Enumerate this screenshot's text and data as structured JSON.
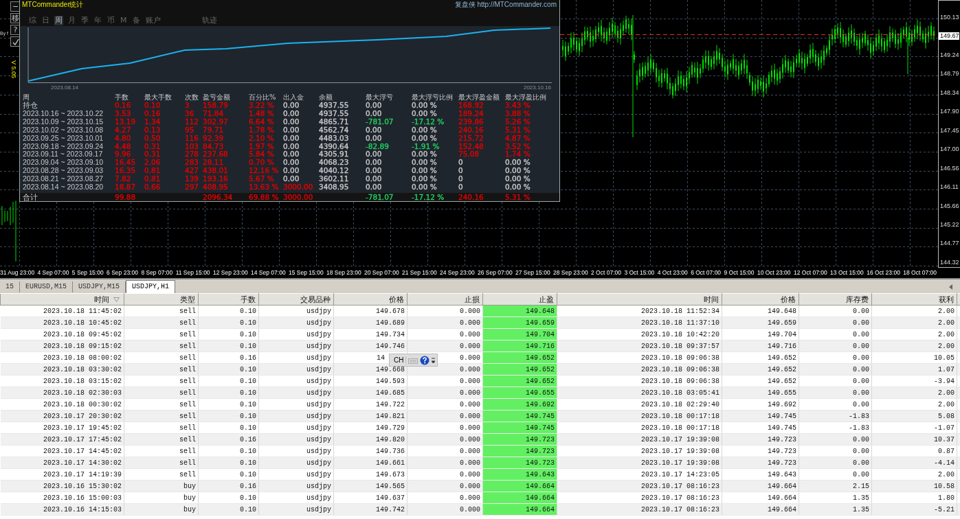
{
  "left_tools": {
    "buttons": [
      "−",
      "移",
      "?"
    ],
    "side_text": "By f",
    "vertical_label": "V 5.05"
  },
  "stats_panel": {
    "title": "MTCommander统计",
    "link": "复盘侠 http://MTCommander.com",
    "tabs": [
      {
        "label": "综",
        "selected": false
      },
      {
        "label": "日",
        "selected": false
      },
      {
        "label": "周",
        "selected": true
      },
      {
        "label": "月",
        "selected": false
      },
      {
        "label": "季",
        "selected": false
      },
      {
        "label": "年",
        "selected": false
      },
      {
        "label": "币",
        "selected": false
      },
      {
        "label": "M",
        "selected": false
      },
      {
        "label": "备",
        "selected": false
      },
      {
        "label": "账户",
        "selected": false
      },
      {
        "label": "轨迹",
        "selected": false
      }
    ],
    "curve_dates": [
      "2023.08.14",
      "2023.10.16"
    ],
    "label_column": "周",
    "columns": [
      "手数",
      "最大手数",
      "次数",
      "盈亏金额",
      "百分比%",
      "出入金",
      "余额",
      "最大浮亏",
      "最大浮亏比例",
      "最大浮盈金额",
      "最大浮盈比例"
    ],
    "rows": [
      {
        "label": "持仓",
        "cells": [
          {
            "text": "0.16",
            "color": "#e00000"
          },
          {
            "text": "0.10",
            "color": "#e00000"
          },
          {
            "text": "3",
            "color": "#e00000"
          },
          {
            "text": "158.79",
            "color": "#e00000"
          },
          {
            "text": "3.22 %",
            "color": "#e00000"
          },
          {
            "text": "0.00",
            "color": "#c8c8c8"
          },
          {
            "text": "4937.55",
            "color": "#c8c8c8"
          },
          {
            "text": "0.00",
            "color": "#c8c8c8"
          },
          {
            "text": "0.00 %",
            "color": "#c8c8c8"
          },
          {
            "text": "168.92",
            "color": "#e00000"
          },
          {
            "text": "3.43 %",
            "color": "#e00000"
          }
        ]
      },
      {
        "label": "2023.10.16 ~ 2023.10.22",
        "cells": [
          {
            "text": "3.53",
            "color": "#e00000"
          },
          {
            "text": "0.16",
            "color": "#e00000"
          },
          {
            "text": "36",
            "color": "#e00000"
          },
          {
            "text": "71.84",
            "color": "#e00000"
          },
          {
            "text": "1.48 %",
            "color": "#e00000"
          },
          {
            "text": "0.00",
            "color": "#c8c8c8"
          },
          {
            "text": "4937.55",
            "color": "#c8c8c8"
          },
          {
            "text": "0.00",
            "color": "#c8c8c8"
          },
          {
            "text": "0.00 %",
            "color": "#c8c8c8"
          },
          {
            "text": "189.24",
            "color": "#e00000"
          },
          {
            "text": "3.88 %",
            "color": "#e00000"
          }
        ]
      },
      {
        "label": "2023.10.09 ~ 2023.10.15",
        "cells": [
          {
            "text": "13.19",
            "color": "#e00000"
          },
          {
            "text": "1.34",
            "color": "#e00000"
          },
          {
            "text": "112",
            "color": "#e00000"
          },
          {
            "text": "302.97",
            "color": "#e00000"
          },
          {
            "text": "6.64 %",
            "color": "#e00000"
          },
          {
            "text": "0.00",
            "color": "#c8c8c8"
          },
          {
            "text": "4865.71",
            "color": "#c8c8c8"
          },
          {
            "text": "-781.07",
            "color": "#20d060"
          },
          {
            "text": "-17.12 %",
            "color": "#20d060"
          },
          {
            "text": "239.86",
            "color": "#e00000"
          },
          {
            "text": "5.26 %",
            "color": "#e00000"
          }
        ]
      },
      {
        "label": "2023.10.02 ~ 2023.10.08",
        "cells": [
          {
            "text": "4.27",
            "color": "#e00000"
          },
          {
            "text": "0.13",
            "color": "#e00000"
          },
          {
            "text": "95",
            "color": "#e00000"
          },
          {
            "text": "79.71",
            "color": "#e00000"
          },
          {
            "text": "1.78 %",
            "color": "#e00000"
          },
          {
            "text": "0.00",
            "color": "#c8c8c8"
          },
          {
            "text": "4562.74",
            "color": "#c8c8c8"
          },
          {
            "text": "0.00",
            "color": "#c8c8c8"
          },
          {
            "text": "0.00 %",
            "color": "#c8c8c8"
          },
          {
            "text": "240.16",
            "color": "#e00000"
          },
          {
            "text": "5.31 %",
            "color": "#e00000"
          }
        ]
      },
      {
        "label": "2023.09.25 ~ 2023.10.01",
        "cells": [
          {
            "text": "4.80",
            "color": "#e00000"
          },
          {
            "text": "0.50",
            "color": "#e00000"
          },
          {
            "text": "116",
            "color": "#e00000"
          },
          {
            "text": "92.39",
            "color": "#e00000"
          },
          {
            "text": "2.10 %",
            "color": "#e00000"
          },
          {
            "text": "0.00",
            "color": "#c8c8c8"
          },
          {
            "text": "4483.03",
            "color": "#c8c8c8"
          },
          {
            "text": "0.00",
            "color": "#c8c8c8"
          },
          {
            "text": "0.00 %",
            "color": "#c8c8c8"
          },
          {
            "text": "215.72",
            "color": "#e00000"
          },
          {
            "text": "4.87 %",
            "color": "#e00000"
          }
        ]
      },
      {
        "label": "2023.09.18 ~ 2023.09.24",
        "cells": [
          {
            "text": "4.48",
            "color": "#e00000"
          },
          {
            "text": "0.31",
            "color": "#e00000"
          },
          {
            "text": "103",
            "color": "#e00000"
          },
          {
            "text": "84.73",
            "color": "#e00000"
          },
          {
            "text": "1.97 %",
            "color": "#e00000"
          },
          {
            "text": "0.00",
            "color": "#c8c8c8"
          },
          {
            "text": "4390.64",
            "color": "#c8c8c8"
          },
          {
            "text": "-82.89",
            "color": "#20d060"
          },
          {
            "text": "-1.91 %",
            "color": "#20d060"
          },
          {
            "text": "152.48",
            "color": "#e00000"
          },
          {
            "text": "3.52 %",
            "color": "#e00000"
          }
        ]
      },
      {
        "label": "2023.09.11 ~ 2023.09.17",
        "cells": [
          {
            "text": "9.96",
            "color": "#e00000"
          },
          {
            "text": "0.31",
            "color": "#e00000"
          },
          {
            "text": "278",
            "color": "#e00000"
          },
          {
            "text": "237.68",
            "color": "#e00000"
          },
          {
            "text": "5.84 %",
            "color": "#e00000"
          },
          {
            "text": "0.00",
            "color": "#c8c8c8"
          },
          {
            "text": "4305.91",
            "color": "#c8c8c8"
          },
          {
            "text": "0.00",
            "color": "#c8c8c8"
          },
          {
            "text": "0.00 %",
            "color": "#c8c8c8"
          },
          {
            "text": "75.08",
            "color": "#e00000"
          },
          {
            "text": "1.74 %",
            "color": "#e00000"
          }
        ]
      },
      {
        "label": "2023.09.04 ~ 2023.09.10",
        "cells": [
          {
            "text": "16.45",
            "color": "#e00000"
          },
          {
            "text": "2.06",
            "color": "#e00000"
          },
          {
            "text": "283",
            "color": "#e00000"
          },
          {
            "text": "28.11",
            "color": "#e00000"
          },
          {
            "text": "0.70 %",
            "color": "#e00000"
          },
          {
            "text": "0.00",
            "color": "#c8c8c8"
          },
          {
            "text": "4068.23",
            "color": "#c8c8c8"
          },
          {
            "text": "0.00",
            "color": "#c8c8c8"
          },
          {
            "text": "0.00 %",
            "color": "#c8c8c8"
          },
          {
            "text": "0",
            "color": "#c8c8c8"
          },
          {
            "text": "0.00 %",
            "color": "#c8c8c8"
          }
        ]
      },
      {
        "label": "2023.08.28 ~ 2023.09.03",
        "cells": [
          {
            "text": "16.35",
            "color": "#e00000"
          },
          {
            "text": "0.81",
            "color": "#e00000"
          },
          {
            "text": "427",
            "color": "#e00000"
          },
          {
            "text": "438.01",
            "color": "#e00000"
          },
          {
            "text": "12.16 %",
            "color": "#e00000"
          },
          {
            "text": "0.00",
            "color": "#c8c8c8"
          },
          {
            "text": "4040.12",
            "color": "#c8c8c8"
          },
          {
            "text": "0.00",
            "color": "#c8c8c8"
          },
          {
            "text": "0.00 %",
            "color": "#c8c8c8"
          },
          {
            "text": "0",
            "color": "#c8c8c8"
          },
          {
            "text": "0.00 %",
            "color": "#c8c8c8"
          }
        ]
      },
      {
        "label": "2023.08.21 ~ 2023.08.27",
        "cells": [
          {
            "text": "7.82",
            "color": "#e00000"
          },
          {
            "text": "0.81",
            "color": "#e00000"
          },
          {
            "text": "139",
            "color": "#e00000"
          },
          {
            "text": "193.16",
            "color": "#e00000"
          },
          {
            "text": "5.67 %",
            "color": "#e00000"
          },
          {
            "text": "0.00",
            "color": "#c8c8c8"
          },
          {
            "text": "3602.11",
            "color": "#c8c8c8"
          },
          {
            "text": "0.00",
            "color": "#c8c8c8"
          },
          {
            "text": "0.00 %",
            "color": "#c8c8c8"
          },
          {
            "text": "0",
            "color": "#c8c8c8"
          },
          {
            "text": "0.00 %",
            "color": "#c8c8c8"
          }
        ]
      },
      {
        "label": "2023.08.14 ~ 2023.08.20",
        "cells": [
          {
            "text": "18.87",
            "color": "#e00000"
          },
          {
            "text": "0.66",
            "color": "#e00000"
          },
          {
            "text": "297",
            "color": "#e00000"
          },
          {
            "text": "408.95",
            "color": "#e00000"
          },
          {
            "text": "13.63 %",
            "color": "#e00000"
          },
          {
            "text": "3000.00",
            "color": "#e00000"
          },
          {
            "text": "3408.95",
            "color": "#c8c8c8"
          },
          {
            "text": "0.00",
            "color": "#c8c8c8"
          },
          {
            "text": "0.00 %",
            "color": "#c8c8c8"
          },
          {
            "text": "0",
            "color": "#c8c8c8"
          },
          {
            "text": "0.00 %",
            "color": "#c8c8c8"
          }
        ]
      }
    ],
    "total": {
      "label": "合计",
      "cells": [
        {
          "text": "99.88",
          "color": "#e00000"
        },
        null,
        null,
        {
          "text": "2096.34",
          "color": "#e00000"
        },
        {
          "text": "69.88 %",
          "color": "#e00000"
        },
        {
          "text": "3000.00",
          "color": "#e00000"
        },
        null,
        {
          "text": "-781.07",
          "color": "#20d060"
        },
        {
          "text": "-17.12 %",
          "color": "#20d060"
        },
        {
          "text": "240.16",
          "color": "#e00000"
        },
        {
          "text": "5.31 %",
          "color": "#e00000"
        }
      ]
    }
  },
  "price_axis": [
    {
      "label": "150.13",
      "current": false
    },
    {
      "label": "149.67",
      "current": true
    },
    {
      "label": "149.24",
      "current": false
    },
    {
      "label": "148.79",
      "current": false
    },
    {
      "label": "148.34",
      "current": false
    },
    {
      "label": "147.90",
      "current": false
    },
    {
      "label": "147.45",
      "current": false
    },
    {
      "label": "147.00",
      "current": false
    },
    {
      "label": "146.56",
      "current": false
    },
    {
      "label": "146.11",
      "current": false
    },
    {
      "label": "145.66",
      "current": false
    },
    {
      "label": "145.22",
      "current": false
    },
    {
      "label": "144.77",
      "current": false
    },
    {
      "label": "144.32",
      "current": false
    }
  ],
  "time_axis": [
    "31 Aug 23:00",
    "4 Sep 07:00",
    "5 Sep 15:00",
    "6 Sep 23:00",
    "8 Sep 07:00",
    "11 Sep 15:00",
    "12 Sep 23:00",
    "14 Sep 07:00",
    "15 Sep 15:00",
    "18 Sep 23:00",
    "20 Sep 07:00",
    "21 Sep 15:00",
    "24 Sep 23:00",
    "26 Sep 07:00",
    "27 Sep 15:00",
    "28 Sep 23:00",
    "2 Oct 07:00",
    "3 Oct 15:00",
    "4 Oct 23:00",
    "6 Oct 07:00",
    "9 Oct 15:00",
    "10 Oct 23:00",
    "12 Oct 07:00",
    "13 Oct 15:00",
    "16 Oct 23:00",
    "18 Oct 07:00"
  ],
  "chart_tabs": [
    {
      "label": "15",
      "selected": false
    },
    {
      "label": "EURUSD,M15",
      "selected": false
    },
    {
      "label": "USDJPY,M15",
      "selected": false
    },
    {
      "label": "USDJPY,H1",
      "selected": true
    }
  ],
  "table": {
    "columns": [
      "时间",
      "类型",
      "手数",
      "交易品种",
      "价格",
      "止损",
      "止盈",
      "时间",
      "价格",
      "库存费",
      "获利"
    ],
    "rows": [
      [
        "2023.10.18 11:45:02",
        "sell",
        "0.10",
        "usdjpy",
        "149.678",
        "0.000",
        "149.648",
        "2023.10.18 11:52:34",
        "149.648",
        "0.00",
        "2.00"
      ],
      [
        "2023.10.18 10:45:02",
        "sell",
        "0.10",
        "usdjpy",
        "149.689",
        "0.000",
        "149.659",
        "2023.10.18 11:37:10",
        "149.659",
        "0.00",
        "2.00"
      ],
      [
        "2023.10.18 09:45:02",
        "sell",
        "0.10",
        "usdjpy",
        "149.734",
        "0.000",
        "149.704",
        "2023.10.18 10:42:20",
        "149.704",
        "0.00",
        "2.00"
      ],
      [
        "2023.10.18 09:15:02",
        "sell",
        "0.10",
        "usdjpy",
        "149.746",
        "0.000",
        "149.716",
        "2023.10.18 09:37:57",
        "149.716",
        "0.00",
        "2.00"
      ],
      [
        "2023.10.18 08:00:02",
        "sell",
        "0.16",
        "usdjpy",
        "14",
        "0.000",
        "149.652",
        "2023.10.18 09:06:38",
        "149.652",
        "0.00",
        "10.05"
      ],
      [
        "2023.10.18 03:30:02",
        "sell",
        "0.10",
        "usdjpy",
        "149.668",
        "0.000",
        "149.652",
        "2023.10.18 09:06:38",
        "149.652",
        "0.00",
        "1.07"
      ],
      [
        "2023.10.18 03:15:02",
        "sell",
        "0.10",
        "usdjpy",
        "149.593",
        "0.000",
        "149.652",
        "2023.10.18 09:06:38",
        "149.652",
        "0.00",
        "-3.94"
      ],
      [
        "2023.10.18 02:30:03",
        "sell",
        "0.10",
        "usdjpy",
        "149.685",
        "0.000",
        "149.655",
        "2023.10.18 03:05:41",
        "149.655",
        "0.00",
        "2.00"
      ],
      [
        "2023.10.18 00:30:02",
        "sell",
        "0.10",
        "usdjpy",
        "149.722",
        "0.000",
        "149.692",
        "2023.10.18 02:29:40",
        "149.692",
        "0.00",
        "2.00"
      ],
      [
        "2023.10.17 20:30:02",
        "sell",
        "0.10",
        "usdjpy",
        "149.821",
        "0.000",
        "149.745",
        "2023.10.18 00:17:18",
        "149.745",
        "-1.83",
        "5.08"
      ],
      [
        "2023.10.17 19:45:02",
        "sell",
        "0.10",
        "usdjpy",
        "149.729",
        "0.000",
        "149.745",
        "2023.10.18 00:17:18",
        "149.745",
        "-1.83",
        "-1.07"
      ],
      [
        "2023.10.17 17:45:02",
        "sell",
        "0.16",
        "usdjpy",
        "149.820",
        "0.000",
        "149.723",
        "2023.10.17 19:39:08",
        "149.723",
        "0.00",
        "10.37"
      ],
      [
        "2023.10.17 14:45:02",
        "sell",
        "0.10",
        "usdjpy",
        "149.736",
        "0.000",
        "149.723",
        "2023.10.17 19:39:08",
        "149.723",
        "0.00",
        "0.87"
      ],
      [
        "2023.10.17 14:30:02",
        "sell",
        "0.10",
        "usdjpy",
        "149.661",
        "0.000",
        "149.723",
        "2023.10.17 19:39:08",
        "149.723",
        "0.00",
        "-4.14"
      ],
      [
        "2023.10.17 14:19:39",
        "sell",
        "0.10",
        "usdjpy",
        "149.673",
        "0.000",
        "149.643",
        "2023.10.17 14:23:05",
        "149.643",
        "0.00",
        "2.00"
      ],
      [
        "2023.10.16 15:30:02",
        "buy",
        "0.16",
        "usdjpy",
        "149.565",
        "0.000",
        "149.664",
        "2023.10.17 08:16:23",
        "149.664",
        "2.15",
        "10.58"
      ],
      [
        "2023.10.16 15:00:03",
        "buy",
        "0.10",
        "usdjpy",
        "149.637",
        "0.000",
        "149.664",
        "2023.10.17 08:16:23",
        "149.664",
        "1.35",
        "1.80"
      ],
      [
        "2023.10.16 14:15:03",
        "buy",
        "0.10",
        "usdjpy",
        "149.742",
        "0.000",
        "149.664",
        "2023.10.17 08:16:23",
        "149.664",
        "1.35",
        "-5.21"
      ]
    ]
  },
  "input_toolbar": {
    "label": "CH"
  }
}
